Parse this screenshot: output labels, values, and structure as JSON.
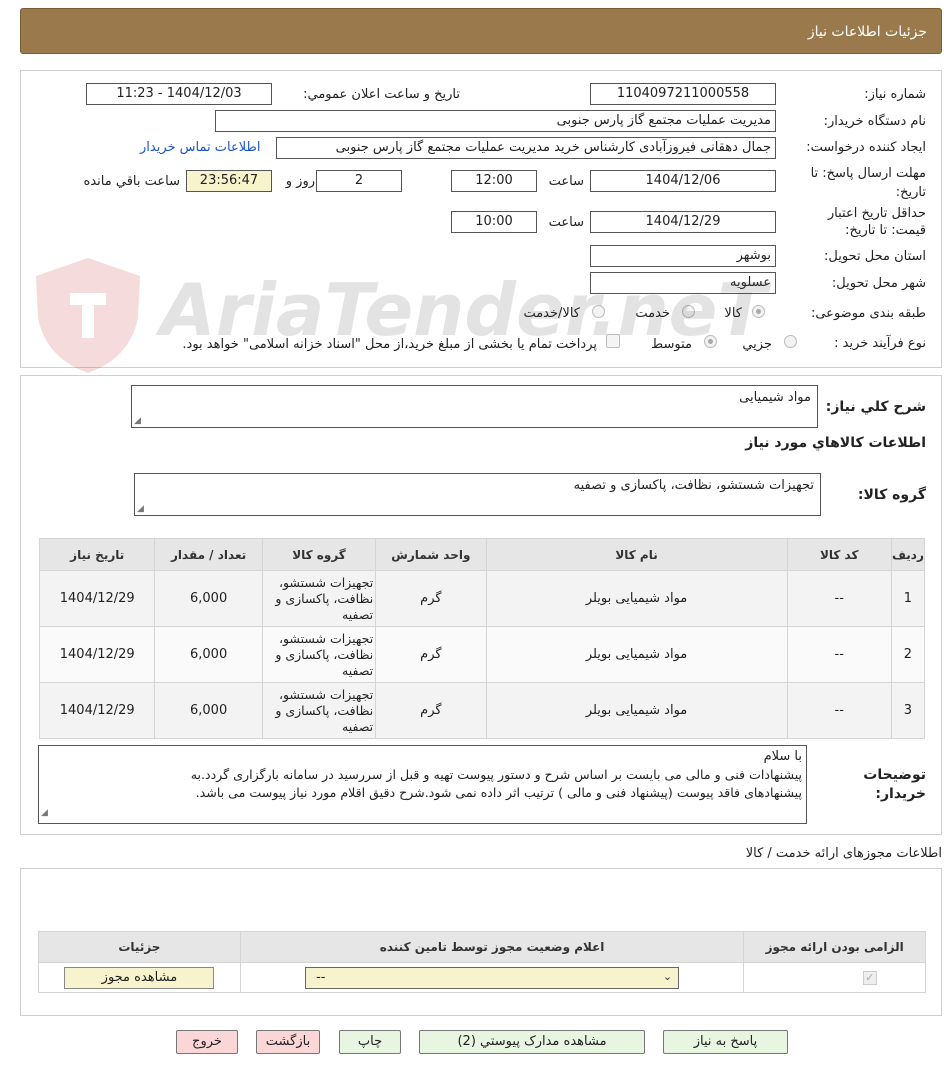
{
  "header": {
    "title": "جزئیات اطلاعات نیاز"
  },
  "form": {
    "need_number_label": "شماره نیاز:",
    "need_number": "1104097211000558",
    "announce_label": "تاریخ و ساعت اعلان عمومي:",
    "announce_value": "1404/12/03 - 11:23",
    "buyer_org_label": "نام دستگاه خريدار:",
    "buyer_org": "مديريت عمليات مجتمع گاز پارس جنوبی",
    "requester_label": "ايجاد كننده درخواست:",
    "requester": "جمال دهقانی فیروزآبادی کارشناس خرید مديريت عمليات مجتمع گاز پارس جنوبی",
    "contact_link": "اطلاعات تماس خريدار",
    "deadline_label_1": "مهلت ارسال پاسخ: تا",
    "deadline_label_2": "تاریخ:",
    "deadline_date": "1404/12/06",
    "time_label": "ساعت",
    "deadline_time": "12:00",
    "days_value": "2",
    "days_label": "روز و",
    "remaining_time": "23:56:47",
    "remaining_label": "ساعت باقي مانده",
    "validity_label_1": "حداقل تاريخ اعتبار",
    "validity_label_2": "قيمت: تا تاريخ:",
    "validity_date": "1404/12/29",
    "validity_time": "10:00",
    "province_label": "استان محل تحويل:",
    "province": "بوشهر",
    "city_label": "شهر محل تحويل:",
    "city": "عسلويه",
    "category_label": "طبقه بندی موضوعی:",
    "category_options": [
      "كالا",
      "خدمت",
      "كالا/خدمت"
    ],
    "process_label": "نوع فرآيند خريد :",
    "process_options": [
      "جزيي",
      "متوسط"
    ],
    "process_note": "پرداخت تمام يا بخشی از مبلغ خريد،از محل \"اسناد خزانه اسلامی\" خواهد بود."
  },
  "description": {
    "label": "شرح كلي نياز:",
    "value": "مواد شيميايی",
    "goods_section_title": "اطلاعات كالاهاي مورد نياز",
    "group_label": "گروه كالا:",
    "group_value": "تجهيزات شستشو، نظافت، پاكسازی و تصفيه"
  },
  "goods_table": {
    "headers": [
      "رديف",
      "كد كالا",
      "نام كالا",
      "واحد شمارش",
      "گروه كالا",
      "تعداد / مقدار",
      "تاريخ نياز"
    ],
    "rows": [
      [
        "1",
        "--",
        "مواد شيميايی بويلر",
        "گرم",
        "تجهيزات شستشو، نظافت، پاكسازی و تصفيه",
        "6,000",
        "1404/12/29"
      ],
      [
        "2",
        "--",
        "مواد شيميايی بويلر",
        "گرم",
        "تجهيزات شستشو، نظافت، پاكسازی و تصفيه",
        "6,000",
        "1404/12/29"
      ],
      [
        "3",
        "--",
        "مواد شيميايی بويلر",
        "گرم",
        "تجهيزات شستشو، نظافت، پاكسازی و تصفيه",
        "6,000",
        "1404/12/29"
      ]
    ]
  },
  "buyer_notes": {
    "label": "توضيحات خريدار:",
    "line1": "با سلام",
    "line2": "پیشنهادات فنی و مالی می بایست بر اساس شرح و دستور پیوست تهیه و قبل از سررسید در سامانه بارگزاری گردد.به",
    "line3": "پیشنهادهای فاقد پیوست (پیشنهاد فنی و مالی ) ترتیب اثر داده نمی شود.شرح دقیق اقلام مورد نیاز پیوست می باشد."
  },
  "permits": {
    "section_title": "اطلاعات مجوزهای ارائه خدمت / كالا",
    "headers": [
      "الزامی بودن ارائه مجوز",
      "اعلام وضعيت مجوز توسط تامين كننده",
      "جزئيات"
    ],
    "status_value": "--",
    "view_button": "مشاهده مجوز"
  },
  "actions": {
    "reply": "پاسخ به نياز",
    "attachments": "مشاهده مدارک پيوستي (2)",
    "print": "چاپ",
    "back": "بازگشت",
    "exit": "خروج"
  },
  "watermark_text": "AriaTender.neT",
  "colors": {
    "header": "#9a7a4c",
    "link": "#1a55c8",
    "table_header": "#e6e6e6"
  }
}
